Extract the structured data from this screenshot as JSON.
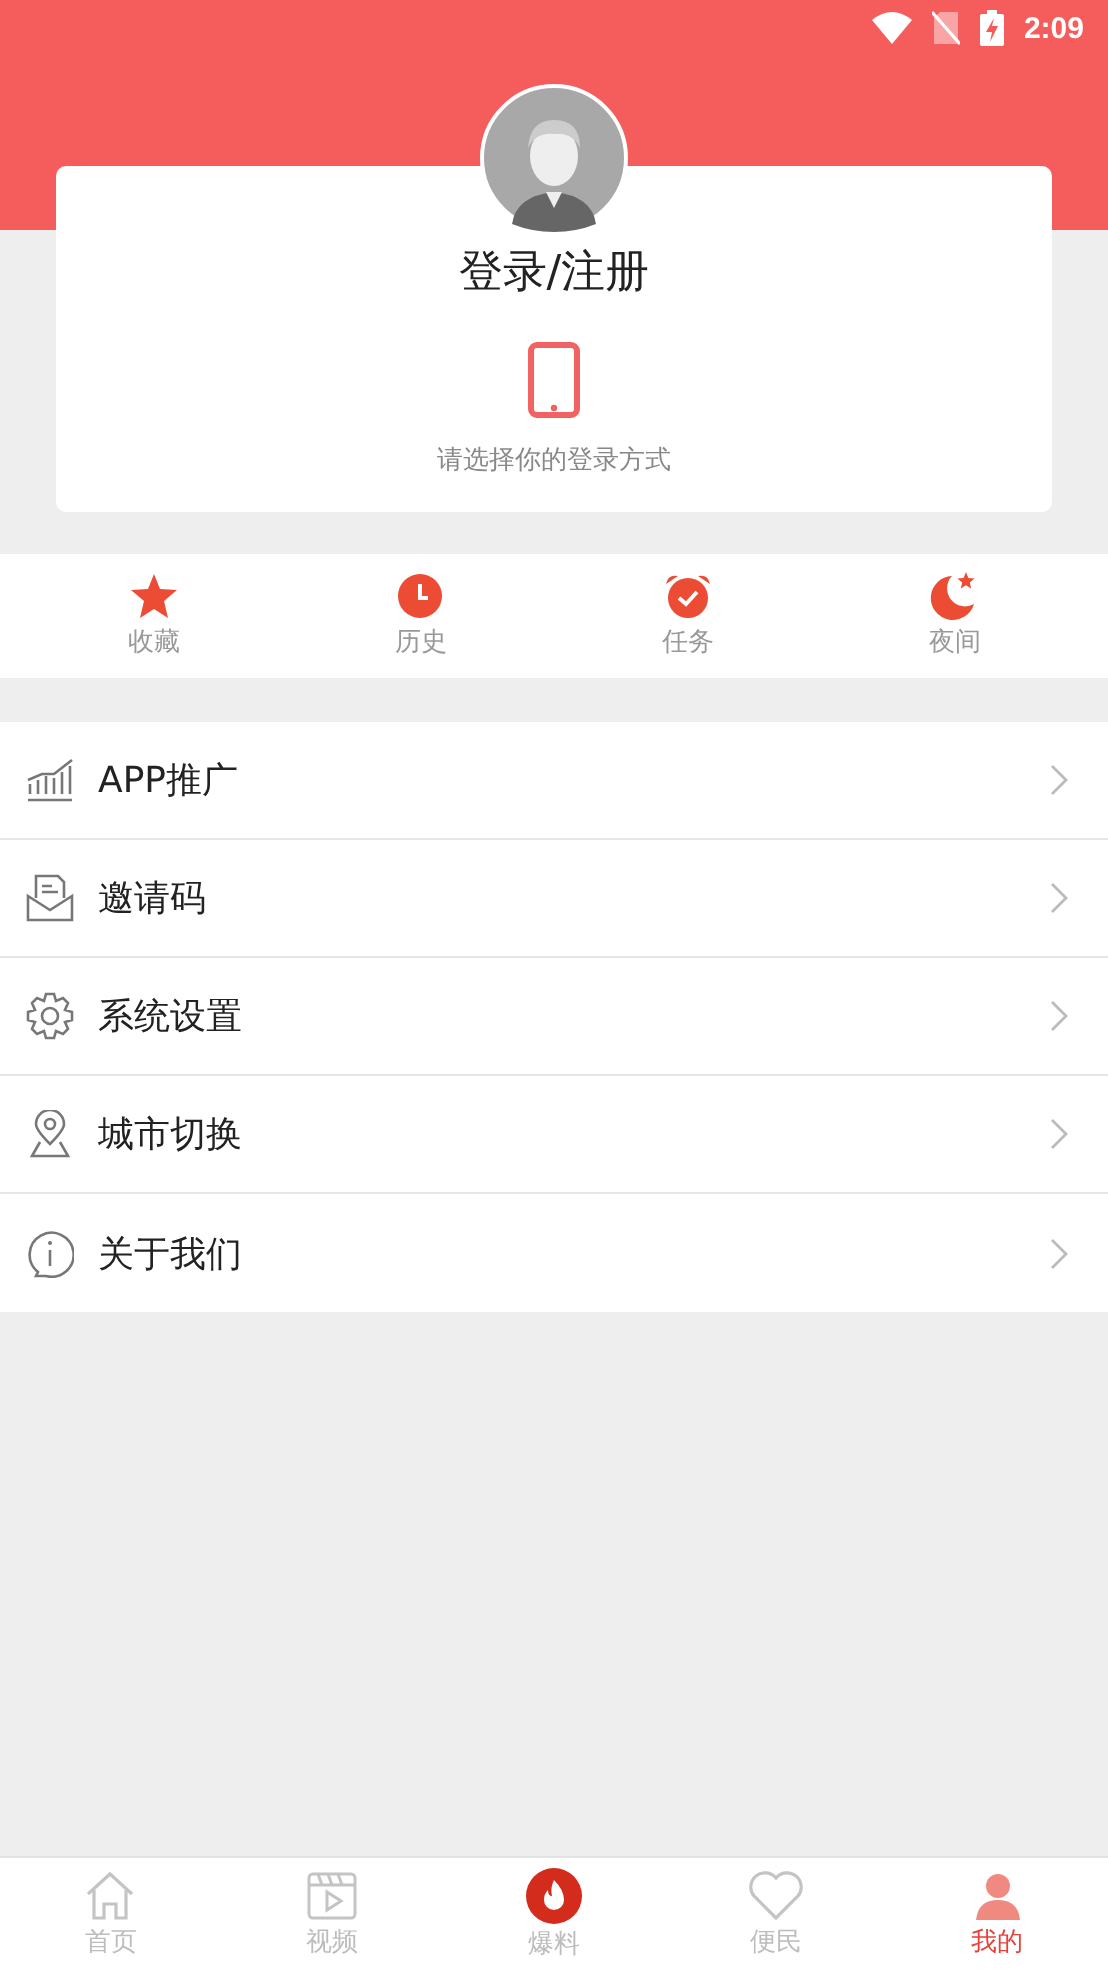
{
  "status_bar": {
    "time": "2:09"
  },
  "profile": {
    "title": "登录/注册",
    "hint": "请选择你的登录方式"
  },
  "shortcuts": [
    {
      "kind": "star",
      "label": "收藏"
    },
    {
      "kind": "clock",
      "label": "历史"
    },
    {
      "kind": "alarm",
      "label": "任务"
    },
    {
      "kind": "moon",
      "label": "夜间"
    }
  ],
  "menu": [
    {
      "kind": "chart",
      "label": "APP推广"
    },
    {
      "kind": "mail",
      "label": "邀请码"
    },
    {
      "kind": "gear",
      "label": "系统设置"
    },
    {
      "kind": "pin",
      "label": "城市切换"
    },
    {
      "kind": "info",
      "label": "关于我们"
    }
  ],
  "tabs": [
    {
      "kind": "home",
      "label": "首页",
      "selected": false
    },
    {
      "kind": "video",
      "label": "视频",
      "selected": false
    },
    {
      "kind": "fire",
      "label": "爆料",
      "selected": false
    },
    {
      "kind": "heart",
      "label": "便民",
      "selected": false
    },
    {
      "kind": "user",
      "label": "我的",
      "selected": true
    }
  ]
}
